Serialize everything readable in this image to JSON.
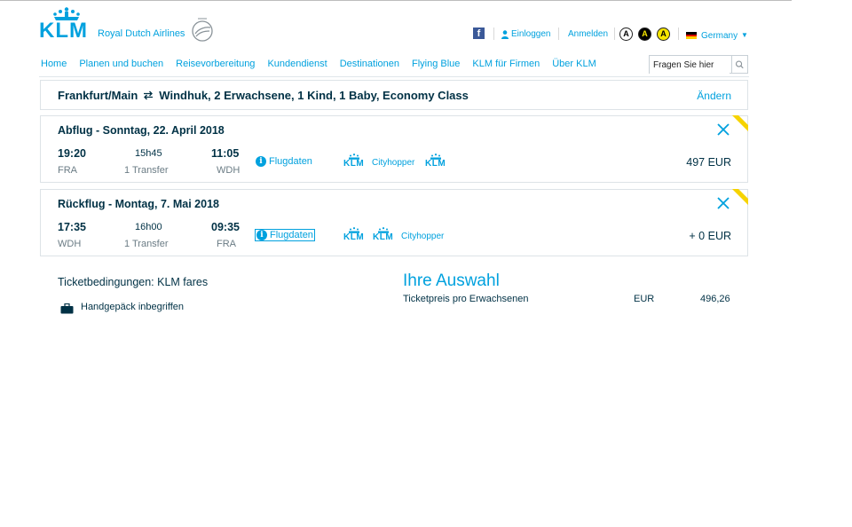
{
  "header": {
    "logo_text": "KLM",
    "brand_sub": "Royal Dutch Airlines",
    "facebook": "f",
    "login": "Einloggen",
    "register": "Anmelden",
    "accessibility": [
      "A",
      "A",
      "A"
    ],
    "country": "Germany",
    "search_placeholder": "Fragen Sie hier"
  },
  "nav": {
    "items": [
      "Home",
      "Planen und buchen",
      "Reisevorbereitung",
      "Kundendienst",
      "Destinationen",
      "Flying Blue",
      "KLM für Firmen",
      "Über KLM"
    ]
  },
  "summary": {
    "origin": "Frankfurt/Main",
    "rest": "Windhuk, 2 Erwachsene, 1 Kind, 1 Baby, Economy Class",
    "change": "Ändern"
  },
  "flights": [
    {
      "title": "Abflug - Sonntag, 22. April 2018",
      "dep_time": "19:20",
      "dep_airport": "FRA",
      "duration": "15h45",
      "transfer": "1 Transfer",
      "arr_time": "11:05",
      "arr_airport": "WDH",
      "details": "Flugdaten",
      "carrier_label": "KLM",
      "cityhopper": "Cityhopper",
      "price": "497 EUR"
    },
    {
      "title": "Rückflug - Montag, 7. Mai 2018",
      "dep_time": "17:35",
      "dep_airport": "WDH",
      "duration": "16h00",
      "transfer": "1 Transfer",
      "arr_time": "09:35",
      "arr_airport": "FRA",
      "details": "Flugdaten",
      "carrier_label": "KLM",
      "cityhopper": "Cityhopper",
      "price": "+ 0 EUR"
    }
  ],
  "conditions": {
    "title": "Ticketbedingungen: KLM fares",
    "baggage": "Handgepäck inbegriffen"
  },
  "selection": {
    "title": "Ihre Auswahl",
    "label": "Ticketpreis pro Erwachsenen",
    "currency": "EUR",
    "amount": "496,26"
  },
  "colors": {
    "brand": "#00a1de",
    "text": "#003145",
    "ribbon": "#f6d300"
  }
}
